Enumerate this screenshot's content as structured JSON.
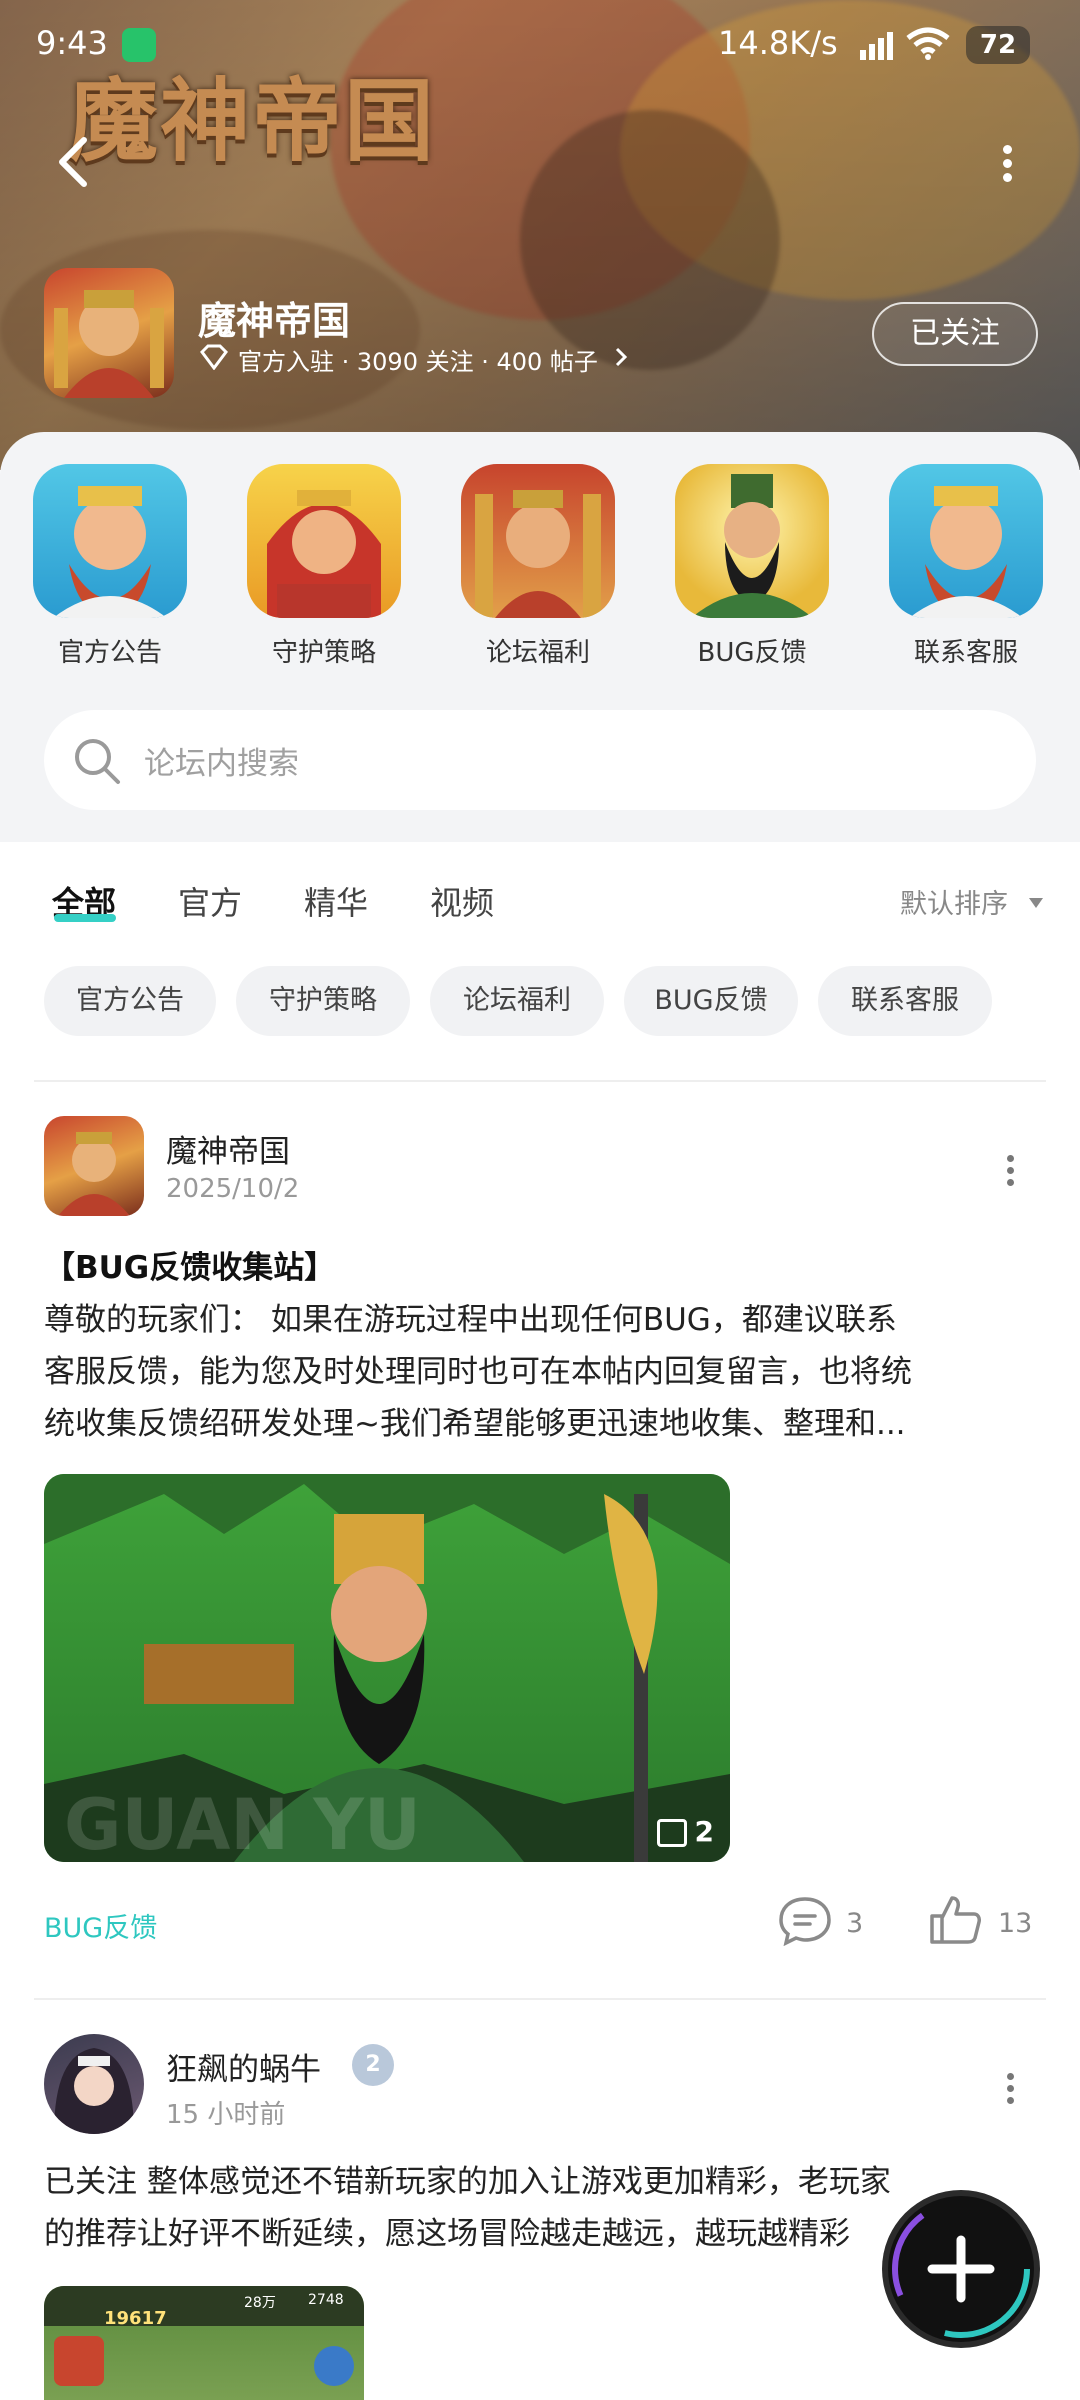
{
  "status": {
    "time": "9:43",
    "speed": "14.8K/s",
    "battery": "72"
  },
  "header": {
    "logo_text": "魔神帝国",
    "forum_name": "魔神帝国",
    "meta": "官方入驻 · 3090 关注 · 400 帖子",
    "follow_label": "已关注"
  },
  "categories": [
    {
      "label": "官方公告",
      "icon": "king-avatar-icon"
    },
    {
      "label": "守护策略",
      "icon": "red-hero-avatar-icon"
    },
    {
      "label": "论坛福利",
      "icon": "golden-hero-avatar-icon"
    },
    {
      "label": "BUG反馈",
      "icon": "bearded-general-avatar-icon"
    },
    {
      "label": "联系客服",
      "icon": "king-avatar-icon"
    }
  ],
  "search": {
    "placeholder": "论坛内搜索"
  },
  "tabs": [
    {
      "label": "全部",
      "active": true
    },
    {
      "label": "官方",
      "active": false
    },
    {
      "label": "精华",
      "active": false
    },
    {
      "label": "视频",
      "active": false
    }
  ],
  "sort_label": "默认排序",
  "chips": [
    "官方公告",
    "守护策略",
    "论坛福利",
    "BUG反馈",
    "联系客服"
  ],
  "posts": [
    {
      "author": "魔神帝国",
      "date": "2025/10/2",
      "title": "【BUG反馈收集站】",
      "lines": [
        "尊敬的玩家们：   如果在游玩过程中出现任何BUG，都建议联系",
        "客服反馈，能为您及时处理同时也可在本帖内回复留言，也将统",
        "统收集反馈绍研发处理~我们希望能够更迅速地收集、整理和..."
      ],
      "image_count": "2",
      "image_watermark": "GUAN YU",
      "tag": "BUG反馈",
      "comments": "3",
      "likes": "13"
    },
    {
      "author": "狂飙的蜗牛",
      "level": "2",
      "date": "15 小时前",
      "lines": [
        "已关注  整体感觉还不错新玩家的加入让游戏更加精彩，老玩家",
        "的推荐让好评不断延续，愿这场冒险越走越远，越玩越精彩"
      ],
      "thumb_numbers": [
        "19617",
        "28万",
        "2748"
      ]
    }
  ],
  "colors": {
    "accent": "#2ec7c0",
    "panel": "#f3f4f6"
  }
}
